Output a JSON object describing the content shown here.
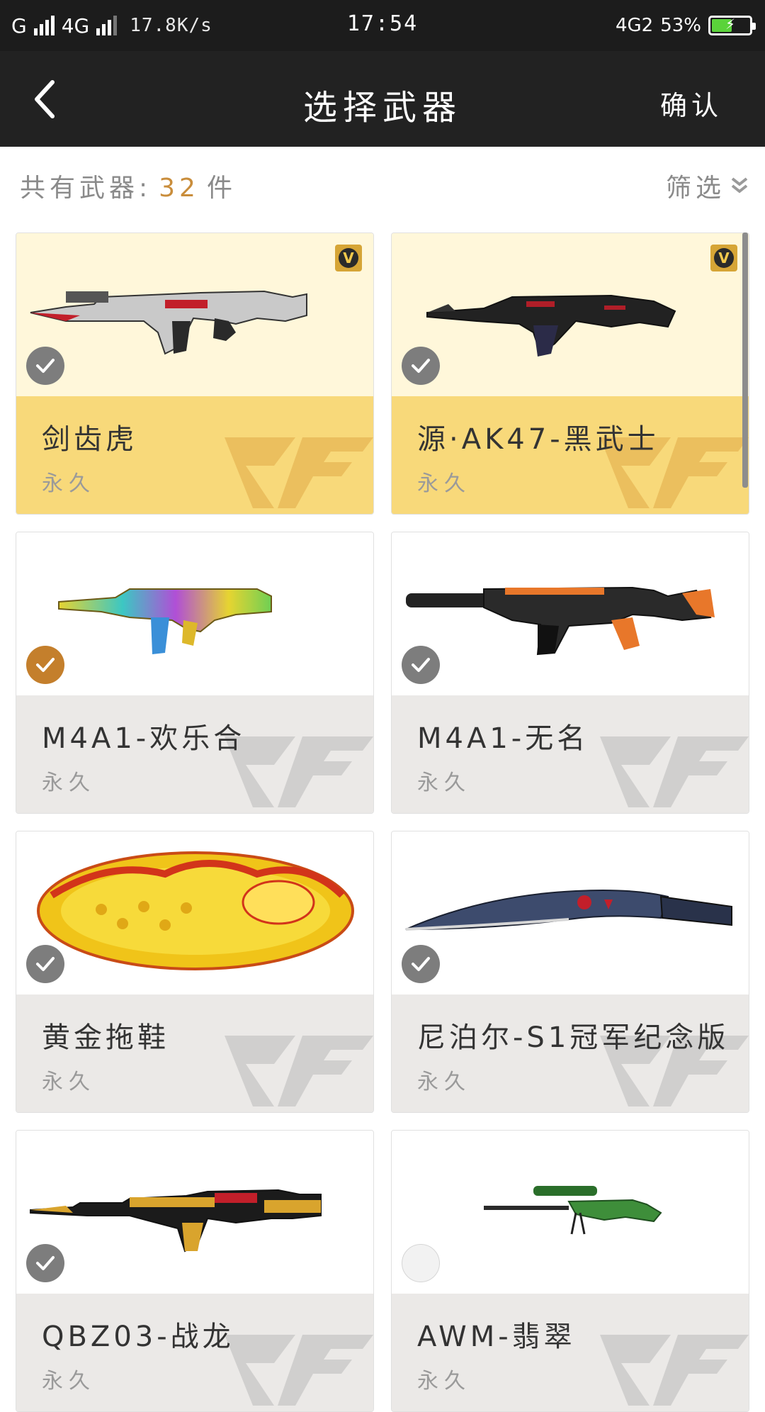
{
  "status_bar": {
    "carrier1": "G",
    "carrier2": "4G",
    "speed": "17.8K/s",
    "time": "17:54",
    "network": "4G2",
    "battery": "53%",
    "battery_level": 0.53
  },
  "nav": {
    "title": "选择武器",
    "confirm": "确认",
    "back_icon": "chevron-left-icon"
  },
  "summary": {
    "prefix": "共有武器:",
    "count": "32",
    "unit": "件",
    "filter_label": "筛选",
    "filter_icon": "double-chevron-down-icon"
  },
  "colors": {
    "selected_top": "#fff7da",
    "selected_bottom": "#f8d97a",
    "check_grey": "#7d7d7d",
    "check_orange": "#c47f2c",
    "count_accent": "#c98d3b"
  },
  "weapons": [
    {
      "name": "剑齿虎",
      "duration": "永久",
      "state": "checked",
      "vip": true,
      "bg": "selected"
    },
    {
      "name": "源·AK47-黑武士",
      "duration": "永久",
      "state": "checked",
      "vip": true,
      "bg": "selected"
    },
    {
      "name": "M4A1-欢乐合",
      "duration": "永久",
      "state": "checked-orange",
      "vip": false,
      "bg": "normal"
    },
    {
      "name": "M4A1-无名",
      "duration": "永久",
      "state": "checked",
      "vip": false,
      "bg": "normal"
    },
    {
      "name": "黄金拖鞋",
      "duration": "永久",
      "state": "checked",
      "vip": false,
      "bg": "normal"
    },
    {
      "name": "尼泊尔-S1冠军纪念版",
      "duration": "永久",
      "state": "checked",
      "vip": false,
      "bg": "normal"
    },
    {
      "name": "QBZ03-战龙",
      "duration": "永久",
      "state": "checked",
      "vip": false,
      "bg": "normal"
    },
    {
      "name": "AWM-翡翠",
      "duration": "永久",
      "state": "unchecked",
      "vip": false,
      "bg": "normal"
    }
  ]
}
